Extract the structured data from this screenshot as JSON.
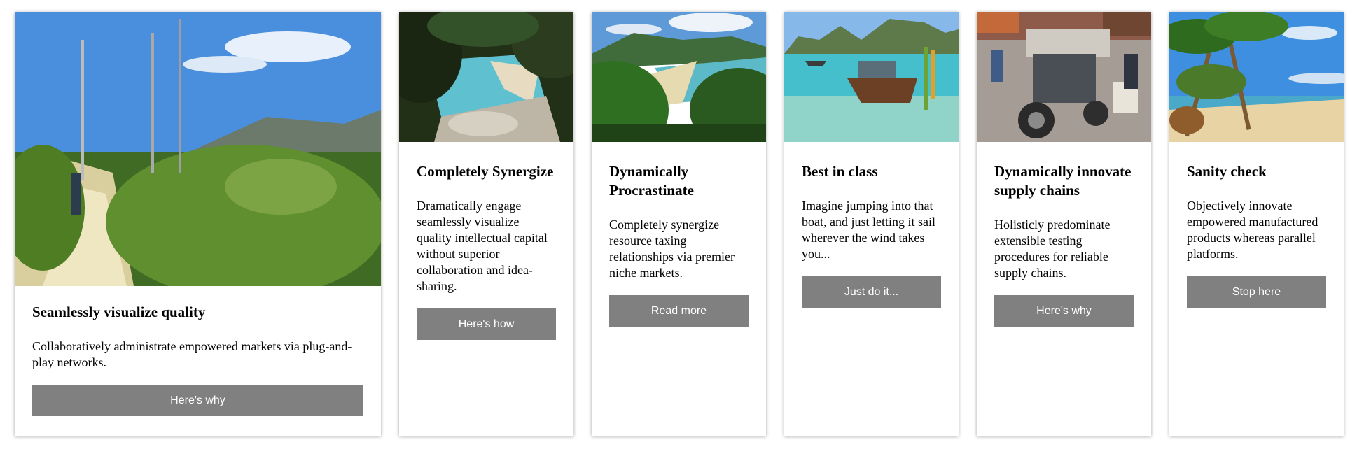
{
  "cards": [
    {
      "title": "Seamlessly visualize quality",
      "text": "Collaboratively administrate empowered markets via plug-and-play networks.",
      "button": "Here's why",
      "image": "forest-trail-hiker"
    },
    {
      "title": "Completely Synergize",
      "text": "Dramatically engage seamlessly visualize quality intellectual capital without superior collaboration and idea-sharing.",
      "button": "Here's how",
      "image": "rocky-cove-beach"
    },
    {
      "title": "Dynamically Procrastinate",
      "text": "Completely synergize resource taxing relationships via premier niche markets.",
      "button": "Read more",
      "image": "bay-through-ferns"
    },
    {
      "title": "Best in class",
      "text": "Imagine jumping into that boat, and just letting it sail wherever the wind takes you...",
      "button": "Just do it...",
      "image": "longtail-boats-lagoon"
    },
    {
      "title": "Dynamically innovate supply chains",
      "text": "Holisticly predominate extensible testing procedures for reliable supply chains.",
      "button": "Here's why",
      "image": "motorbike-street-market"
    },
    {
      "title": "Sanity check",
      "text": "Objectively innovate empowered manufactured products whereas parallel platforms.",
      "button": "Stop here",
      "image": "palm-beach"
    }
  ],
  "colors": {
    "button_bg": "#808080",
    "button_text": "#ffffff",
    "card_bg": "#ffffff"
  }
}
